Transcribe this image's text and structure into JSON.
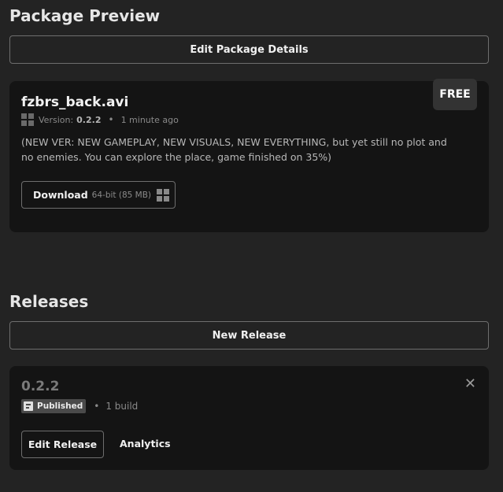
{
  "package_preview": {
    "title": "Package Preview",
    "edit_button": "Edit Package Details",
    "card": {
      "name": "fzbrs_back.avi",
      "badge": "FREE",
      "version_label": "Version:",
      "version": "0.2.2",
      "time_ago": "1 minute ago",
      "platform_icon": "windows-icon",
      "description": "(NEW VER: NEW GAMEPLAY, NEW VISUALS, NEW EVERYTHING, but yet still no plot and no enemies. You can explore the place, game finished on 35%)",
      "download": {
        "label": "Download",
        "meta": "64-bit (85 MB)",
        "icon": "windows-icon"
      }
    }
  },
  "releases": {
    "title": "Releases",
    "new_button": "New Release",
    "items": [
      {
        "version": "0.2.2",
        "status": "Published",
        "builds": "1 build",
        "close_icon": "close-icon",
        "edit_button": "Edit Release",
        "analytics_link": "Analytics"
      }
    ]
  },
  "colors": {
    "background": "#232323",
    "card": "#141414",
    "badge": "#333333",
    "border": "#6e6e6e"
  }
}
